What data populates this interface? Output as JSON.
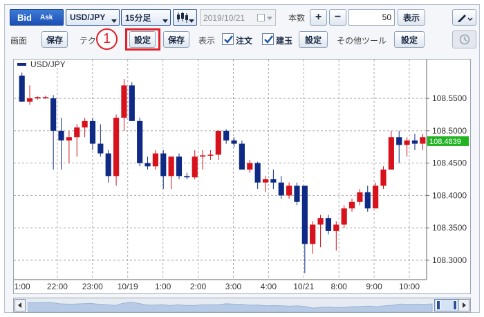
{
  "toolbar": {
    "bid_label": "Bid",
    "ask_label": "Ask",
    "pair": "USD/JPY",
    "interval": "15分足",
    "date_value": "2019/10/21",
    "count_label": "本数",
    "plus": "+",
    "minus": "−",
    "count_value": "50",
    "display_button": "表示"
  },
  "row2": {
    "screen_label": "画面",
    "save1": "保存",
    "tech_label": "テク",
    "step_marker": "1",
    "settings1": "設定",
    "save2": "保存",
    "display_label": "表示",
    "order_label": "注文",
    "position_label": "建玉",
    "settings2": "設定",
    "other_tools_label": "その他ツール",
    "settings3": "設定"
  },
  "icons": {
    "candle": "candlestick-icon",
    "calendar": "calendar-icon",
    "pencil": "pencil-icon",
    "history": "history-icon"
  },
  "colors": {
    "up": "#d7121d",
    "down": "#0e2a84",
    "accent": "#1f57c4",
    "price_tag": "#22b323",
    "highlight": "#e0202a"
  },
  "chart_data": {
    "type": "candlestick",
    "legend": "USD/JPY",
    "current_price": "108.4839",
    "y_ticks": [
      "108.5500",
      "108.5000",
      "108.4500",
      "108.4000",
      "108.3500",
      "108.3000"
    ],
    "y_tick_values": [
      108.55,
      108.5,
      108.45,
      108.4,
      108.35,
      108.3
    ],
    "ylim": [
      108.27,
      108.61
    ],
    "x_labels": [
      "1:00",
      "22:00",
      "23:00",
      "10/19",
      "1:00",
      "2:00",
      "3:00",
      "4:00",
      "10/21",
      "8:00",
      "9:00",
      "10:00"
    ],
    "candles": [
      [
        108.585,
        108.59,
        108.545,
        108.545
      ],
      [
        108.545,
        108.57,
        108.54,
        108.55
      ],
      [
        108.55,
        108.553,
        108.548,
        108.552
      ],
      [
        108.552,
        108.554,
        108.549,
        108.552
      ],
      [
        108.55,
        108.555,
        108.44,
        108.5
      ],
      [
        108.5,
        108.52,
        108.44,
        108.485
      ],
      [
        108.485,
        108.5,
        108.45,
        108.49
      ],
      [
        108.49,
        108.51,
        108.46,
        108.505
      ],
      [
        108.505,
        108.52,
        108.49,
        108.515
      ],
      [
        108.515,
        108.52,
        108.47,
        108.48
      ],
      [
        108.48,
        108.51,
        108.46,
        108.465
      ],
      [
        108.465,
        108.47,
        108.42,
        108.43
      ],
      [
        108.43,
        108.525,
        108.415,
        108.52
      ],
      [
        108.52,
        108.58,
        108.5,
        108.57
      ],
      [
        108.57,
        108.575,
        108.515,
        108.515
      ],
      [
        108.515,
        108.52,
        108.445,
        108.45
      ],
      [
        108.45,
        108.46,
        108.44,
        108.445
      ],
      [
        108.445,
        108.47,
        108.44,
        108.465
      ],
      [
        108.465,
        108.47,
        108.41,
        108.43
      ],
      [
        108.43,
        108.455,
        108.41,
        108.46
      ],
      [
        108.46,
        108.465,
        108.425,
        108.43
      ],
      [
        108.43,
        108.435,
        108.425,
        108.428
      ],
      [
        108.428,
        108.47,
        108.425,
        108.46
      ],
      [
        108.46,
        108.47,
        108.44,
        108.462
      ],
      [
        108.462,
        108.47,
        108.455,
        108.463
      ],
      [
        108.463,
        108.5,
        108.455,
        108.5
      ],
      [
        108.5,
        108.502,
        108.48,
        108.485
      ],
      [
        108.485,
        108.49,
        108.475,
        108.48
      ],
      [
        108.48,
        108.485,
        108.44,
        108.44
      ],
      [
        108.44,
        108.455,
        108.435,
        108.45
      ],
      [
        108.45,
        108.452,
        108.41,
        108.42
      ],
      [
        108.42,
        108.43,
        108.405,
        108.425
      ],
      [
        108.425,
        108.44,
        108.41,
        108.42
      ],
      [
        108.42,
        108.43,
        108.395,
        108.4
      ],
      [
        108.4,
        108.42,
        108.395,
        108.415
      ],
      [
        108.415,
        108.42,
        108.385,
        108.39
      ],
      [
        108.415,
        108.415,
        108.28,
        108.325
      ],
      [
        108.325,
        108.36,
        108.31,
        108.355
      ],
      [
        108.355,
        108.37,
        108.32,
        108.365
      ],
      [
        108.365,
        108.37,
        108.34,
        108.345
      ],
      [
        108.345,
        108.36,
        108.315,
        108.355
      ],
      [
        108.355,
        108.385,
        108.35,
        108.38
      ],
      [
        108.38,
        108.395,
        108.375,
        108.39
      ],
      [
        108.39,
        108.41,
        108.385,
        108.405
      ],
      [
        108.405,
        108.415,
        108.375,
        108.38
      ],
      [
        108.38,
        108.42,
        108.38,
        108.415
      ],
      [
        108.415,
        108.445,
        108.41,
        108.44
      ],
      [
        108.44,
        108.5,
        108.44,
        108.49
      ],
      [
        108.49,
        108.5,
        108.45,
        108.478
      ],
      [
        108.478,
        108.49,
        108.46,
        108.485
      ],
      [
        108.485,
        108.495,
        108.47,
        108.48
      ],
      [
        108.48,
        108.495,
        108.47,
        108.49
      ]
    ]
  }
}
